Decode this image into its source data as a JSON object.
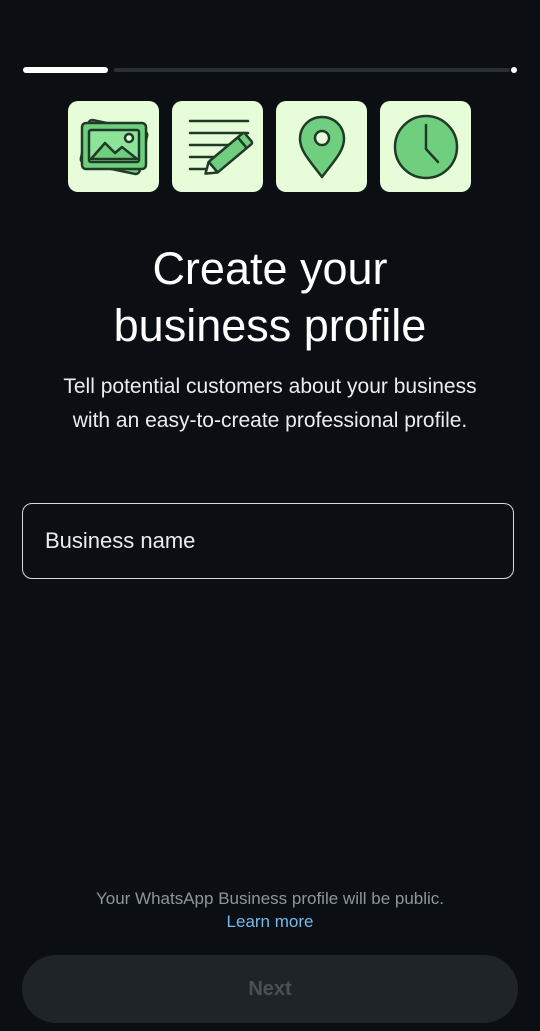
{
  "progress": {
    "steps_completed": 1,
    "total_steps": 6
  },
  "tiles": [
    {
      "icon": "photo-cards-icon"
    },
    {
      "icon": "notes-pencil-icon"
    },
    {
      "icon": "location-pin-icon"
    },
    {
      "icon": "clock-icon"
    }
  ],
  "colors": {
    "background": "#0b0f13",
    "tile_background": "#e7fcd9",
    "icon_green": "#6fcf7f",
    "icon_stroke": "#1f3a27",
    "link": "#7ab8e8",
    "button_disabled_bg": "#1f2428",
    "button_disabled_text": "#4a5155"
  },
  "title": {
    "line1": "Create your",
    "line2": "business profile"
  },
  "description": "Tell potential customers about your business with an easy-to-create professional profile.",
  "business_name_input": {
    "placeholder": "Business name",
    "value": ""
  },
  "notice": "Your WhatsApp Business profile will be public.",
  "learn_more": "Learn more",
  "next_button": {
    "label": "Next",
    "enabled": false
  }
}
